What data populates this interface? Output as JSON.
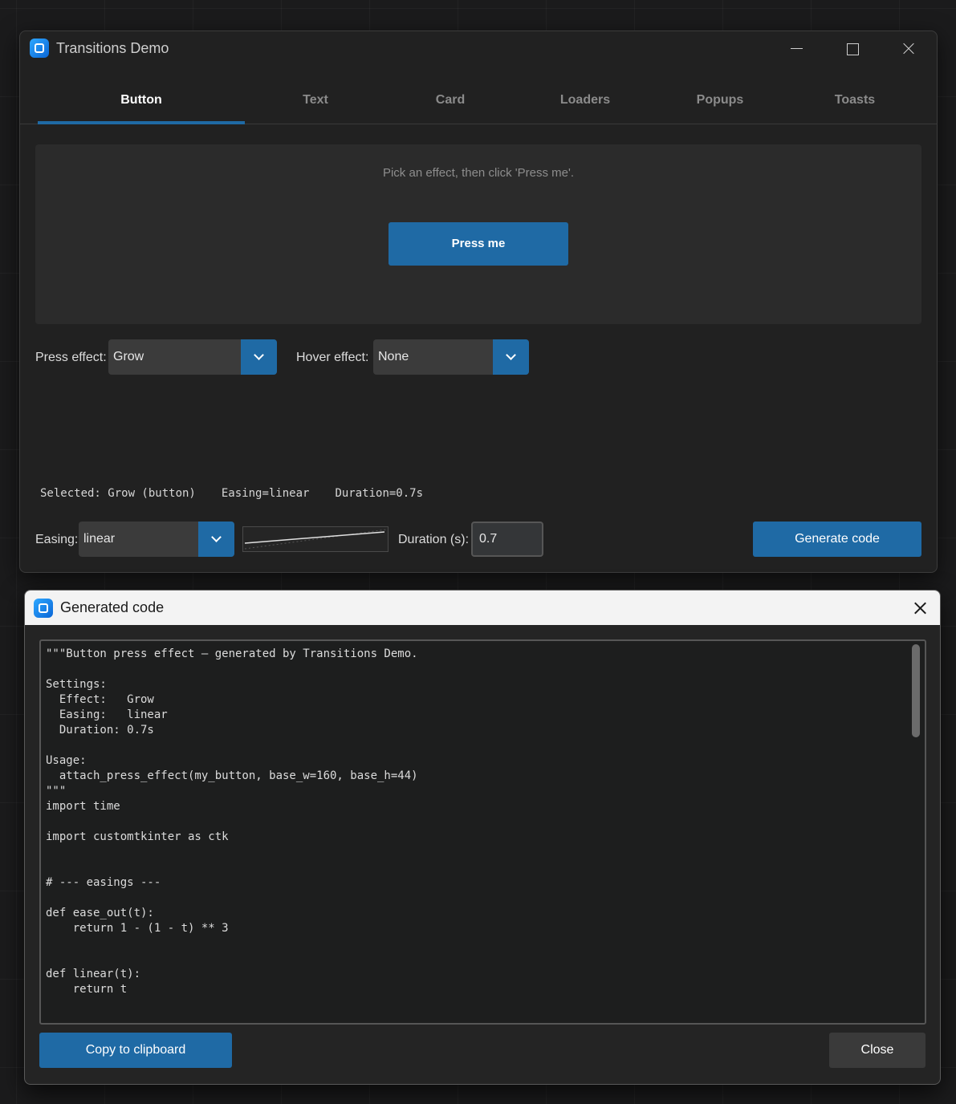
{
  "main_window": {
    "title": "Transitions Demo",
    "tabs": [
      {
        "label": "Button",
        "active": true
      },
      {
        "label": "Text",
        "active": false
      },
      {
        "label": "Card",
        "active": false
      },
      {
        "label": "Loaders",
        "active": false
      },
      {
        "label": "Popups",
        "active": false
      },
      {
        "label": "Toasts",
        "active": false
      }
    ],
    "preview": {
      "hint": "Pick an effect, then click 'Press me'.",
      "button_label": "Press me"
    },
    "press_effect": {
      "label": "Press effect:",
      "value": "Grow"
    },
    "hover_effect": {
      "label": "Hover effect:",
      "value": "None"
    },
    "status": {
      "selected": "Selected: Grow (button)",
      "easing": "Easing=linear",
      "duration": "Duration=0.7s"
    },
    "easing": {
      "label": "Easing:",
      "value": "linear"
    },
    "duration": {
      "label": "Duration (s):",
      "value": "0.7"
    },
    "generate_label": "Generate code"
  },
  "code_window": {
    "title": "Generated code",
    "code": "\"\"\"Button press effect – generated by Transitions Demo.\n\nSettings:\n  Effect:   Grow\n  Easing:   linear\n  Duration: 0.7s\n\nUsage:\n  attach_press_effect(my_button, base_w=160, base_h=44)\n\"\"\"\nimport time\n\nimport customtkinter as ctk\n\n\n# --- easings ---\n\ndef ease_out(t):\n    return 1 - (1 - t) ** 3\n\n\ndef linear(t):\n    return t",
    "copy_label": "Copy to clipboard",
    "close_label": "Close"
  },
  "colors": {
    "accent": "#1f6aa5",
    "window_bg": "#212121",
    "panel_bg": "#2b2b2b"
  }
}
